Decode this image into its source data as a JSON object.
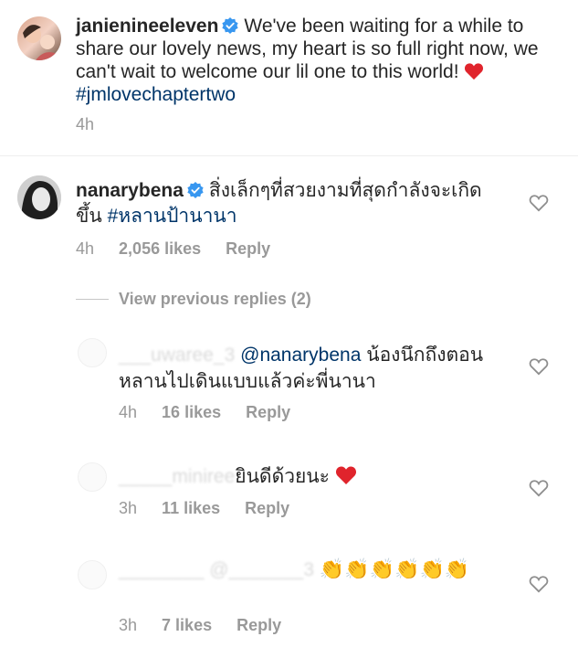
{
  "post": {
    "username": "janienineeleven",
    "caption": "We've been waiting for a while to share our lovely news, my heart is so full right now, we can't wait to welcome our lil one to this world!",
    "hashtag": "#jmlovechaptertwo",
    "time": "4h"
  },
  "comment": {
    "username": "nanarybena",
    "text": "สิ่งเล็กๆที่สวยงามที่สุดกำลังจะเกิดขึ้น",
    "hashtag": "#หลานป้านานา",
    "time": "4h",
    "likes": "2,056 likes",
    "reply": "Reply"
  },
  "view_previous": "View previous replies (2)",
  "replies": [
    {
      "user_blurred": "___uwaree_3",
      "mention": "@nanarybena",
      "text": "น้องนึกถึงตอนหลานไปเดินแบบแล้วค่ะพี่นานา",
      "time": "4h",
      "likes": "16 likes",
      "reply": "Reply"
    },
    {
      "user_blurred": "_____miniree",
      "text": "ยินดีด้วยนะ",
      "time": "3h",
      "likes": "11 likes",
      "reply": "Reply"
    },
    {
      "user_blurred": "________ @_______3",
      "emoji": "👏👏👏👏👏👏",
      "time": "3h",
      "likes": "7 likes",
      "reply": "Reply"
    }
  ],
  "colors": {
    "link": "#003569",
    "verified": "#3897f0",
    "heart": "#ed4956",
    "meta": "#999999"
  },
  "icons": [
    "verified-badge-icon",
    "heart-outline-icon",
    "red-heart-emoji"
  ]
}
